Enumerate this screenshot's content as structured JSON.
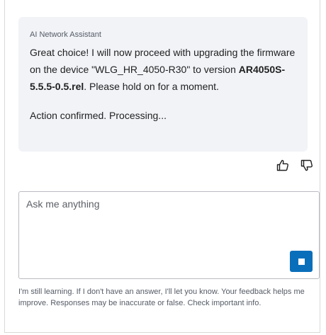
{
  "message": {
    "sender": "AI Network Assistant",
    "text_before": "Great choice! I will now proceed with upgrading the firmware on the device \"WLG_HR_4050-R30\" to version ",
    "version": "AR4050S-5.5.5-0.5.rel",
    "text_after": ". Please hold on for a moment.",
    "status": "Action confirmed. Processing..."
  },
  "feedback": {
    "like_icon": "thumbs-up-icon",
    "dislike_icon": "thumbs-down-icon"
  },
  "composer": {
    "placeholder": "Ask me anything",
    "stop_icon": "stop-icon",
    "accent_color": "#0a6fba"
  },
  "disclaimer": "I'm still learning. If I don't have an answer, I'll let you know. Your feedback helps me improve. Responses may be inaccurate or false. Check important info."
}
